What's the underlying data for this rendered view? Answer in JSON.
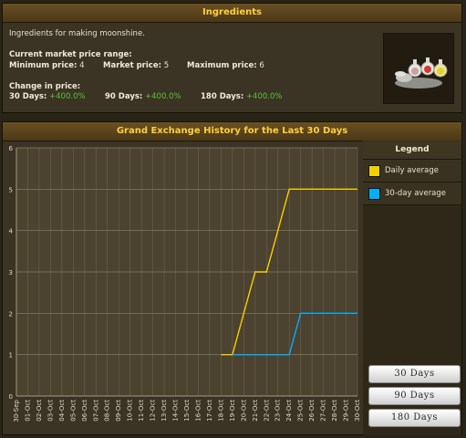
{
  "info": {
    "title": "Ingredients",
    "description": "Ingredients for making moonshine.",
    "price_range_label": "Current market price range:",
    "min_label": "Minimum price:",
    "min_value": "4",
    "market_label": "Market price:",
    "market_value": "5",
    "max_label": "Maximum price:",
    "max_value": "6",
    "change_label": "Change in price:",
    "change_30_label": "30 Days:",
    "change_30_value": "+400.0%",
    "change_90_label": "90 Days:",
    "change_90_value": "+400.0%",
    "change_180_label": "180 Days:",
    "change_180_value": "+400.0%",
    "item_image_icon": "moonshine-ingredients-icon"
  },
  "history": {
    "title": "Grand Exchange History for the Last 30 Days"
  },
  "legend": {
    "title": "Legend",
    "items": [
      {
        "label": "Daily average",
        "color": "#f5d000"
      },
      {
        "label": "30-day average",
        "color": "#00b0ff"
      }
    ]
  },
  "range_buttons": [
    "30 Days",
    "90 Days",
    "180 Days"
  ],
  "chart_data": {
    "type": "line",
    "ylim": [
      0,
      6
    ],
    "yticks": [
      "0",
      "1",
      "2",
      "3",
      "4",
      "5",
      "6"
    ],
    "categories": [
      "30-Sep",
      "01-Oct",
      "02-Oct",
      "03-Oct",
      "04-Oct",
      "05-Oct",
      "06-Oct",
      "07-Oct",
      "08-Oct",
      "09-Oct",
      "10-Oct",
      "11-Oct",
      "12-Oct",
      "13-Oct",
      "14-Oct",
      "15-Oct",
      "16-Oct",
      "17-Oct",
      "18-Oct",
      "19-Oct",
      "20-Oct",
      "21-Oct",
      "22-Oct",
      "23-Oct",
      "24-Oct",
      "25-Oct",
      "26-Oct",
      "27-Oct",
      "28-Oct",
      "29-Oct",
      "30-Oct"
    ],
    "series": [
      {
        "name": "Daily average",
        "color": "#f5d000",
        "points": [
          [
            "18-Oct",
            1
          ],
          [
            "19-Oct",
            1
          ],
          [
            "20-Oct",
            2
          ],
          [
            "21-Oct",
            3
          ],
          [
            "22-Oct",
            3
          ],
          [
            "23-Oct",
            4
          ],
          [
            "24-Oct",
            5
          ],
          [
            "25-Oct",
            5
          ],
          [
            "26-Oct",
            5
          ],
          [
            "27-Oct",
            5
          ],
          [
            "28-Oct",
            5
          ],
          [
            "29-Oct",
            5
          ],
          [
            "30-Oct",
            5
          ]
        ]
      },
      {
        "name": "30-day average",
        "color": "#00b0ff",
        "points": [
          [
            "19-Oct",
            1
          ],
          [
            "20-Oct",
            1
          ],
          [
            "21-Oct",
            1
          ],
          [
            "22-Oct",
            1
          ],
          [
            "23-Oct",
            1
          ],
          [
            "24-Oct",
            1
          ],
          [
            "25-Oct",
            2
          ],
          [
            "26-Oct",
            2
          ],
          [
            "27-Oct",
            2
          ],
          [
            "28-Oct",
            2
          ],
          [
            "29-Oct",
            2
          ],
          [
            "30-Oct",
            2
          ]
        ]
      }
    ],
    "grid": true,
    "legend_position": "right"
  }
}
